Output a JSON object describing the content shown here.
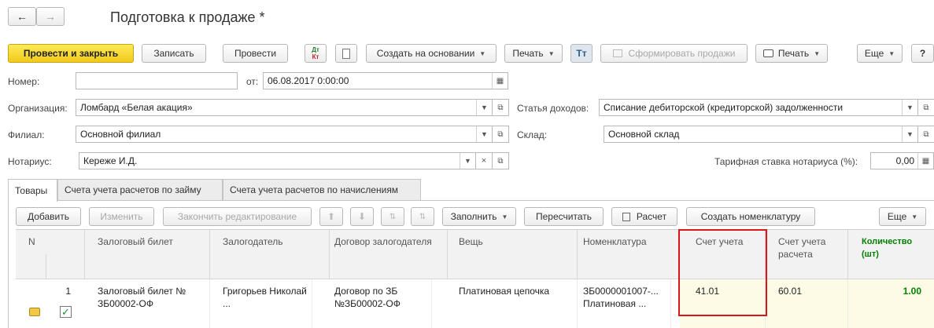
{
  "window": {
    "title": "Подготовка к продаже *"
  },
  "nav": {
    "back_glyph": "🡐",
    "forward_glyph": "🡒"
  },
  "toolbar": {
    "post_close": "Провести и закрыть",
    "write": "Записать",
    "post": "Провести",
    "dtkt_top": "Дт",
    "dtkt_bottom": "Кт",
    "create_based": "Создать на основании",
    "print": "Печать",
    "tt_glyph": "Тт",
    "form_sales": "Сформировать продажи",
    "print2": "Печать",
    "more": "Еще",
    "help": "?"
  },
  "form": {
    "number_label": "Номер:",
    "number_value": "",
    "date_from_label": "от:",
    "date_value": "06.08.2017  0:00:00",
    "org_label": "Организация:",
    "org_value": "Ломбард «Белая акация»",
    "branch_label": "Филиал:",
    "branch_value": "Основной филиал",
    "notary_label": "Нотариус:",
    "notary_value": "Кереже И.Д.",
    "income_label": "Статья доходов:",
    "income_value": "Списание дебиторской (кредиторской) задолженности",
    "warehouse_label": "Склад:",
    "warehouse_value": "Основной склад",
    "rate_label": "Тарифная ставка нотариуса (%):",
    "rate_value": "0,00"
  },
  "tabs": [
    {
      "label": "Товары"
    },
    {
      "label": "Счета учета расчетов по займу"
    },
    {
      "label": "Счета учета расчетов по начислениям"
    }
  ],
  "table_toolbar": {
    "add": "Добавить",
    "edit": "Изменить",
    "finish_edit": "Закончить редактирование",
    "fill": "Заполнить",
    "recalc": "Пересчитать",
    "calc": "Расчет",
    "create_nom": "Создать номенклатуру",
    "more": "Еще"
  },
  "table": {
    "columns": [
      "N",
      "Залоговый билет",
      "Залогодатель",
      "Договор залогодателя",
      "Вещь",
      "Номенклатура",
      "Счет учета",
      "Счет учета расчета",
      "Количество (шт)"
    ],
    "row": {
      "n": "1",
      "ticket": "Залоговый билет № ЗБ00002-ОФ",
      "pledger": "Григорьев Николай ...",
      "contract": "Договор по ЗБ №ЗБ00002-ОФ",
      "item": "Платиновая цепочка",
      "nomenclature": "ЗБ0000001007-... Платиновая ...",
      "account": "41.01",
      "settle_account": "60.01",
      "quantity": "1.00"
    }
  },
  "colors": {
    "highlight": "#d8161b",
    "qty_header": "#008000",
    "primary_button": "#f5d430"
  }
}
